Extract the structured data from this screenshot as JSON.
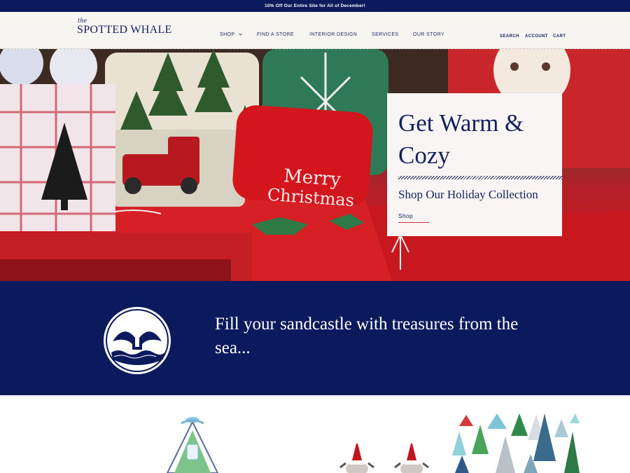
{
  "announcement": {
    "text": "10% Off Our Entire Site for All of December!"
  },
  "header": {
    "logo_small": "the",
    "logo_name": "SPOTTED WHALE",
    "nav": [
      {
        "label": "SHOP",
        "has_dropdown": true
      },
      {
        "label": "FIND A STORE"
      },
      {
        "label": "INTERIOR DESIGN"
      },
      {
        "label": "SERVICES"
      },
      {
        "label": "OUR STORY"
      }
    ],
    "utility": [
      {
        "label": "SEARCH"
      },
      {
        "label": "ACCOUNT"
      },
      {
        "label": "CART"
      }
    ]
  },
  "hero": {
    "headline": "Get Warm & Cozy",
    "subheadline": "Shop Our Holiday Collection",
    "cta": "Shop",
    "pillow_text_1": "Merry",
    "pillow_text_2": "Christmas"
  },
  "band": {
    "tagline": "Fill your sandcastle with treasures from the sea..."
  },
  "colors": {
    "navy": "#0b1a5c",
    "accent_red": "#c8313a",
    "header_bg": "#f7f5f1"
  },
  "icons": [
    "chevron-down-icon",
    "whale-tail-icon"
  ]
}
